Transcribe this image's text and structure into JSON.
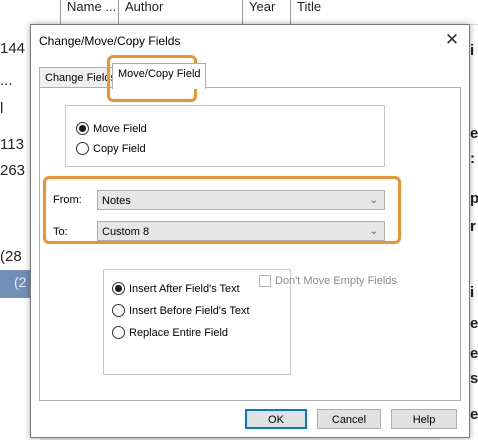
{
  "background": {
    "header_cols": [
      "Name ...",
      "Author",
      "Year",
      "Title"
    ],
    "left_texts": [
      "144",
      "...",
      "l",
      "113",
      "263",
      "(28",
      "(2"
    ],
    "right_texts": [
      "i",
      "e",
      ":",
      "p",
      "r",
      "i",
      "e",
      "e",
      "s",
      "e"
    ]
  },
  "dialog": {
    "title": "Change/Move/Copy Fields",
    "close_glyph": "✕",
    "tabs": [
      {
        "label": "Change Fields"
      },
      {
        "label": "Move/Copy Field"
      }
    ],
    "mode": {
      "options": [
        {
          "label": "Move Field",
          "selected": true
        },
        {
          "label": "Copy Field",
          "selected": false
        }
      ]
    },
    "from": {
      "label": "From:",
      "value": "Notes"
    },
    "to": {
      "label": "To:",
      "value": "Custom 8"
    },
    "insert": {
      "options": [
        {
          "label": "Insert After Field's Text",
          "selected": true
        },
        {
          "label": "Insert Before Field's Text",
          "selected": false
        },
        {
          "label": "Replace Entire Field",
          "selected": false
        }
      ]
    },
    "dont_move_empty": {
      "label": "Don't Move Empty Fields",
      "checked": false,
      "enabled": false
    },
    "buttons": {
      "ok": "OK",
      "cancel": "Cancel",
      "help": "Help"
    }
  },
  "highlight_color": "#f0922e"
}
